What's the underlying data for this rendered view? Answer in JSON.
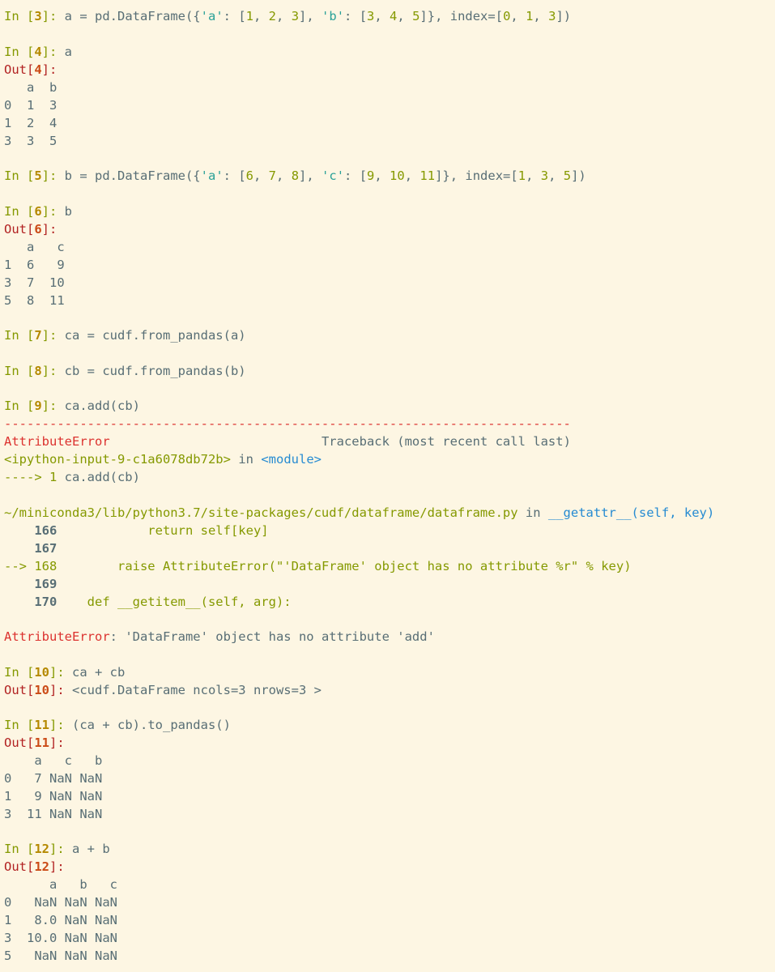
{
  "cells": [
    {
      "in": "3",
      "pre": "a = pd.DataFrame({",
      "s_a": "'a'",
      "mid1": ": [",
      "v1": "1",
      "v2": "2",
      "v3": "3",
      "mid2": "], ",
      "s_b": "'b'",
      "mid3": ": [",
      "v4": "3",
      "v5": "4",
      "v6": "5",
      "mid4": "]}, index=[",
      "i1": "0",
      "i2": "1",
      "i3": "3",
      "end": "])"
    },
    {
      "in": "4",
      "code": "a",
      "out": "4",
      "table": [
        "   a  b",
        "0  1  3",
        "1  2  4",
        "3  3  5"
      ]
    },
    {
      "in": "5",
      "pre": "b = pd.DataFrame({",
      "s_a": "'a'",
      "mid1": ": [",
      "v1": "6",
      "v2": "7",
      "v3": "8",
      "mid2": "], ",
      "s_b": "'c'",
      "mid3": ": [",
      "v4": "9",
      "v5": "10",
      "v6": "11",
      "mid4": "]}, index=[",
      "i1": "1",
      "i2": "3",
      "i3": "5",
      "end": "])"
    },
    {
      "in": "6",
      "code": "b",
      "out": "6",
      "table": [
        "   a   c",
        "1  6   9",
        "3  7  10",
        "5  8  11"
      ]
    },
    {
      "in": "7",
      "code": "ca = cudf.from_pandas(a)"
    },
    {
      "in": "8",
      "code": "cb = cudf.from_pandas(b)"
    },
    {
      "in": "9",
      "code": "ca.add(cb)"
    },
    {
      "in": "10",
      "code": "ca + cb",
      "out": "10",
      "result": "<cudf.DataFrame ncols=3 nrows=3 >"
    },
    {
      "in": "11",
      "code": "(ca + cb).to_pandas()",
      "out": "11",
      "table": [
        "    a   c   b",
        "0   7 NaN NaN",
        "1   9 NaN NaN",
        "3  11 NaN NaN"
      ]
    },
    {
      "in": "12",
      "code": "a + b",
      "out": "12",
      "table": [
        "      a   b   c",
        "0   NaN NaN NaN",
        "1   8.0 NaN NaN",
        "3  10.0 NaN NaN",
        "5   NaN NaN NaN"
      ]
    }
  ],
  "traceback": {
    "dashes": "---------------------------------------------------------------------------",
    "error_name": "AttributeError",
    "header": "Traceback (most recent call last)",
    "input_ref": "<ipython-input-9-c1a6078db72b>",
    "in_word": "in",
    "module": "<module>",
    "arrow1": "----> 1 ",
    "arrow1_code": "ca.add(cb)",
    "file_path": "~/miniconda3/lib/python3.7/site-packages/cudf/dataframe/dataframe.py",
    "func": "__getattr__(self, key)",
    "l166": "166",
    "l166_code": "            return self[key]",
    "l167": "167",
    "arrow2": "--> 168",
    "l168_code": "        raise AttributeError(\"'DataFrame' object has no attribute %r\" % key)",
    "l169": "169",
    "l170": "170",
    "l170_code": "    def __getitem__(self, arg):",
    "final_error": "AttributeError",
    "final_msg": ": 'DataFrame' object has no attribute 'add'"
  },
  "prompt": {
    "in_label": "In [",
    "out_label": "Out[",
    "close": "]: "
  }
}
